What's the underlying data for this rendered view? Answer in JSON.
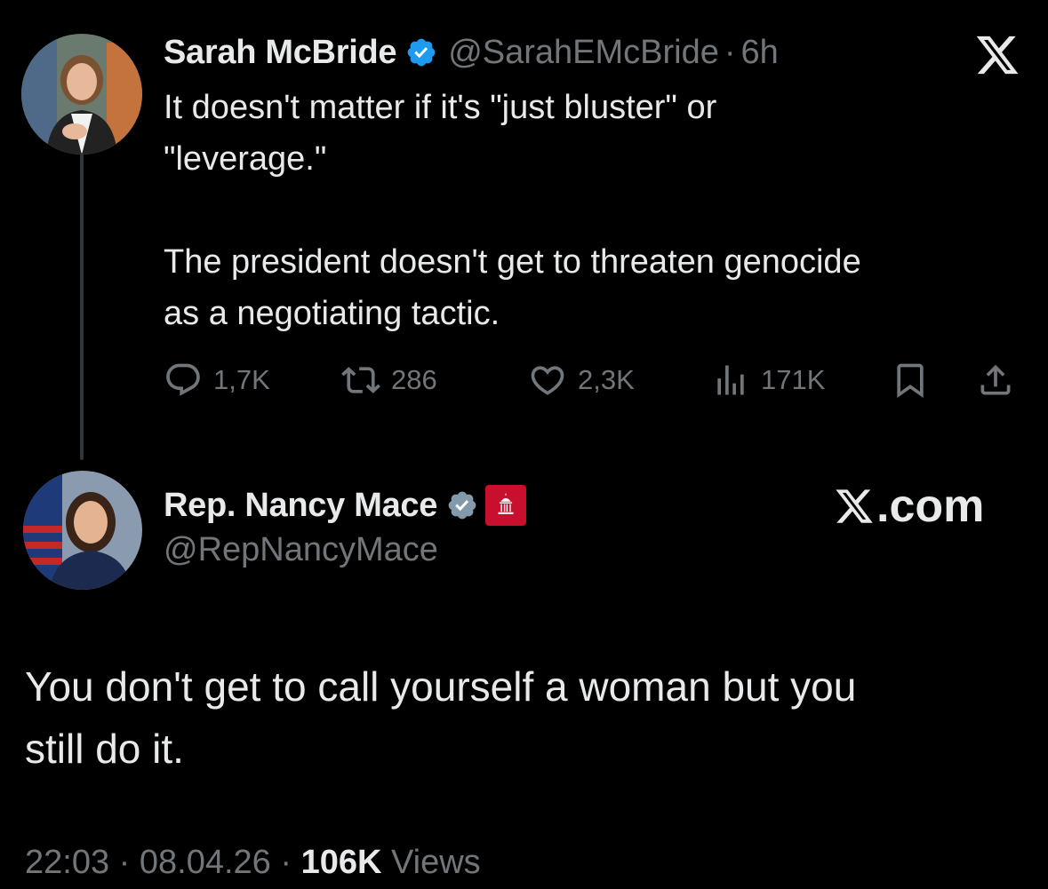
{
  "tweet": {
    "author": {
      "name": "Sarah McBride",
      "handle": "@SarahEMcBride",
      "time": "6h",
      "verified_color": "#1d9bf0"
    },
    "text_line1": "It doesn't matter if it's \"just bluster\" or",
    "text_line2": "\"leverage.\"",
    "text_line3": "The president doesn't get to threaten genocide",
    "text_line4": "as a negotiating tactic.",
    "actions": {
      "replies": "1,7K",
      "reposts": "286",
      "likes": "2,3K",
      "views": "171K"
    }
  },
  "reply": {
    "author": {
      "name": "Rep. Nancy Mace",
      "handle": "@RepNancyMace",
      "verified_color": "#829aab",
      "gov_badge_color": "#c8102e"
    },
    "text_line1": "You don't get to call yourself a woman but you",
    "text_line2": "still do it.",
    "timestamp": "22:03 · 08.04.26 · ",
    "views_count": "106K",
    "views_label": "Views"
  },
  "watermark": {
    "site": ".com"
  },
  "icons": [
    "x-logo-icon",
    "verified-badge-icon",
    "reply-icon",
    "repost-icon",
    "like-icon",
    "views-icon",
    "bookmark-icon",
    "share-icon",
    "government-badge-icon"
  ],
  "colors": {
    "background": "#000000",
    "text": "#e7e9ea",
    "muted": "#71767b",
    "accent": "#1d9bf0"
  }
}
